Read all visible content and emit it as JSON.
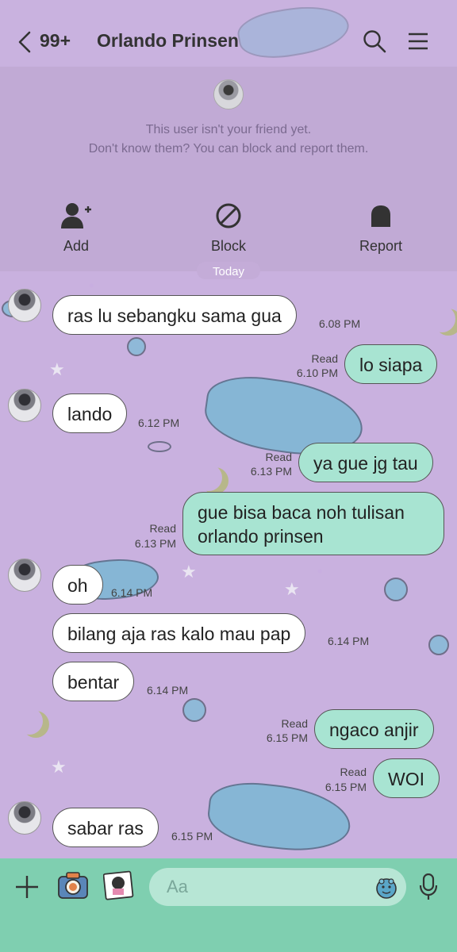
{
  "header": {
    "unread_count": "99+",
    "title": "Orlando Prinsen"
  },
  "notice": {
    "line1": "This user isn't your friend yet.",
    "line2": "Don't know them? You can block and report them.",
    "actions": {
      "add": "Add",
      "block": "Block",
      "report": "Report"
    }
  },
  "date_divider": "Today",
  "messages": [
    {
      "side": "in",
      "text": "ras lu sebangku sama gua",
      "time": "6.08 PM"
    },
    {
      "side": "out",
      "text": "lo siapa",
      "read": "Read",
      "time": "6.10 PM"
    },
    {
      "side": "in",
      "text": "lando",
      "time": "6.12 PM"
    },
    {
      "side": "out",
      "text": "ya gue jg tau",
      "read": "Read",
      "time": "6.13 PM"
    },
    {
      "side": "out",
      "text": "gue bisa baca noh tulisan orlando prinsen",
      "read": "Read",
      "time": "6.13 PM"
    },
    {
      "side": "in",
      "text": "oh",
      "time": "6.14 PM"
    },
    {
      "side": "in",
      "text": "bilang aja ras kalo mau pap",
      "time": "6.14 PM"
    },
    {
      "side": "in",
      "text": "bentar",
      "time": "6.14 PM"
    },
    {
      "side": "out",
      "text": "ngaco anjir",
      "read": "Read",
      "time": "6.15 PM"
    },
    {
      "side": "out",
      "text": "WOI",
      "read": "Read",
      "time": "6.15 PM"
    },
    {
      "side": "in",
      "text": "sabar ras",
      "time": "6.15 PM"
    }
  ],
  "input": {
    "placeholder": "Aa"
  },
  "colors": {
    "background": "#c9b1df",
    "outgoing_bubble": "#a8e4d2",
    "incoming_bubble": "#ffffff",
    "input_bar": "#7fcfb0"
  }
}
